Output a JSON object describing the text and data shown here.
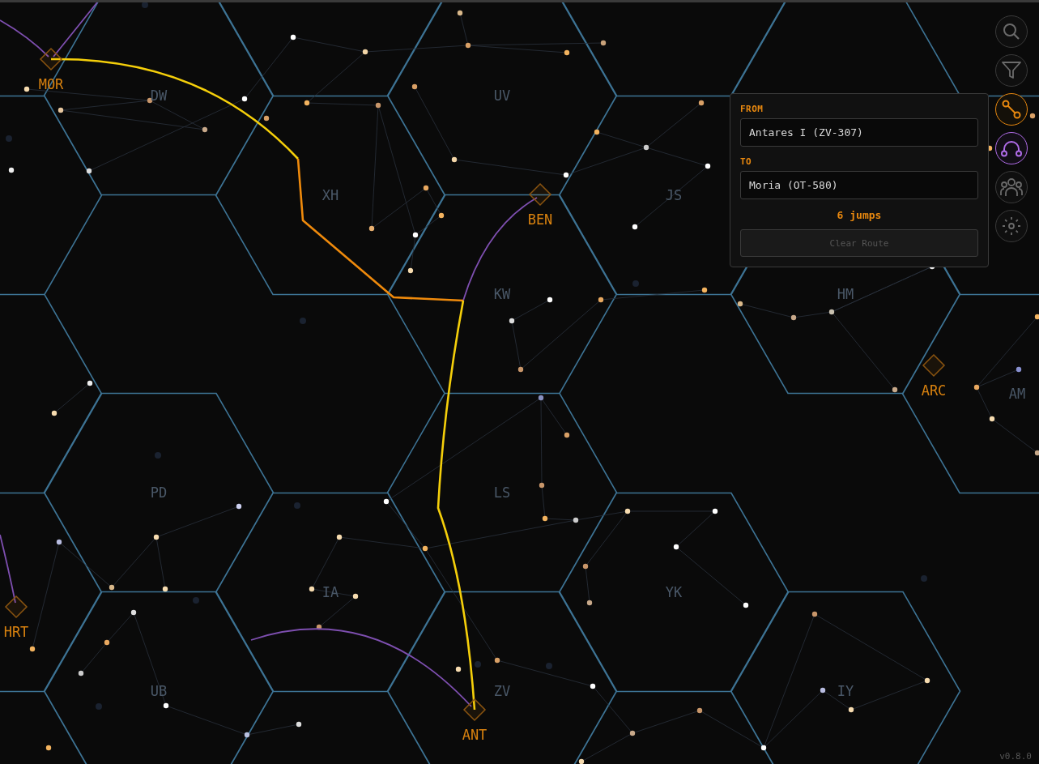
{
  "sectors": [
    {
      "label": "DW"
    },
    {
      "label": "UV"
    },
    {
      "label": "XH"
    },
    {
      "label": "JS"
    },
    {
      "label": "KW"
    },
    {
      "label": "HM"
    },
    {
      "label": "AM"
    },
    {
      "label": "PD"
    },
    {
      "label": "LS"
    },
    {
      "label": "IA"
    },
    {
      "label": "YK"
    },
    {
      "label": "UB"
    },
    {
      "label": "ZV"
    },
    {
      "label": "IY"
    }
  ],
  "systems": [
    {
      "label": "MOR"
    },
    {
      "label": "BEN"
    },
    {
      "label": "ARC"
    },
    {
      "label": "HRT"
    },
    {
      "label": "ANT"
    }
  ],
  "route_panel": {
    "from_label": "FROM",
    "from_value": "Antares I (ZV-307)",
    "to_label": "TO",
    "to_value": "Moria (OT-580)",
    "jumps": "6 jumps",
    "clear_button": {
      "label": "Clear Route",
      "disabled": true
    }
  },
  "toolbar": [
    {
      "kind": "search",
      "selected": false
    },
    {
      "kind": "filter",
      "selected": false
    },
    {
      "kind": "route",
      "selected": true
    },
    {
      "kind": "wormhole",
      "selected": true
    },
    {
      "kind": "factions",
      "selected": false
    },
    {
      "kind": "settings",
      "selected": false
    }
  ],
  "version": "v0.8.0"
}
